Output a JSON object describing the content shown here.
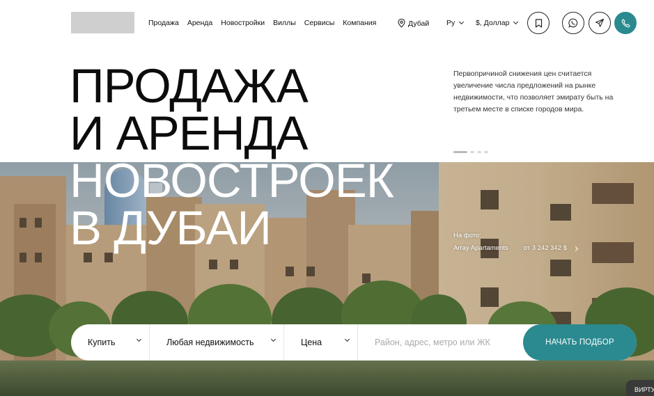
{
  "header": {
    "nav": [
      {
        "label": "Продажа"
      },
      {
        "label": "Аренда"
      },
      {
        "label": "Новостройки"
      },
      {
        "label": "Виллы"
      },
      {
        "label": "Сервисы"
      },
      {
        "label": "Компания"
      }
    ],
    "city": "Дубай",
    "language": "Ру",
    "currency": "$, Доллар"
  },
  "hero": {
    "lines": [
      "ПРОДАЖА",
      "И АРЕНДА",
      "НОВОСТРОЕК",
      "В ДУБАИ"
    ],
    "description": "Первопричиной снижения цен считается увеличение числа предложений на рынке недвижимости, что позволяет эмирату быть на третьем месте в списке городов мира.",
    "caption_label": "На фото:",
    "caption_name": "Array Apartaments",
    "caption_price": "от 3 242 342 $"
  },
  "search": {
    "deal_type": "Купить",
    "property_type": "Любая недвижимость",
    "price": "Цена",
    "query_placeholder": "Район, адрес, метро или ЖК",
    "submit": "НАЧАТЬ ПОДБОР"
  },
  "virtual_tour": "ВИРТУ",
  "icons": {
    "city": "location-pin-icon",
    "favorites": "bookmark-icon",
    "whatsapp": "whatsapp-icon",
    "telegram": "telegram-icon",
    "phone": "phone-icon"
  },
  "colors": {
    "accent": "#2a8a8f",
    "text": "#111111"
  }
}
